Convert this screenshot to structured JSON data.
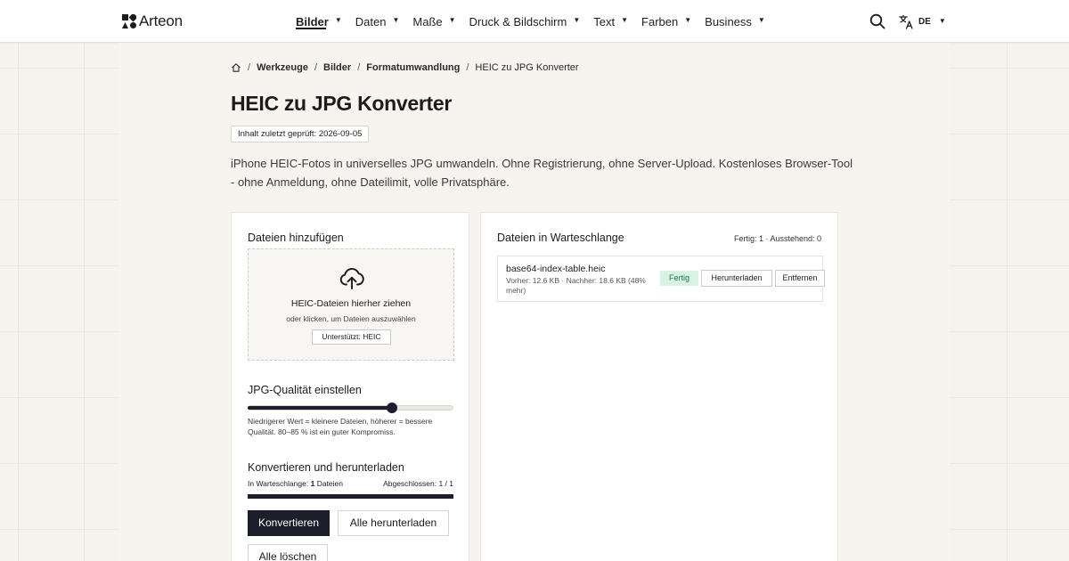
{
  "brand": {
    "name": "Arteon"
  },
  "nav": {
    "items": [
      {
        "label": "Bilder",
        "active": true
      },
      {
        "label": "Daten"
      },
      {
        "label": "Maße"
      },
      {
        "label": "Druck & Bildschirm"
      },
      {
        "label": "Text"
      },
      {
        "label": "Farben"
      },
      {
        "label": "Business"
      }
    ],
    "caret_glyph": "▼"
  },
  "header": {
    "search_icon": "search-icon",
    "language_icon": "translate-icon",
    "language_code": "DE"
  },
  "breadcrumb": {
    "home_icon": "home-icon",
    "separator": "/",
    "items": [
      "Werkzeuge",
      "Bilder",
      "Formatumwandlung"
    ],
    "current": "HEIC zu JPG Konverter"
  },
  "page": {
    "title": "HEIC zu JPG Konverter",
    "reviewed": "Inhalt zuletzt geprüft: 2026-09-05",
    "intro": "iPhone HEIC-Fotos in universelles JPG umwandeln. Ohne Registrierung, ohne Server-Upload. Kostenloses Browser-Tool - ohne Anmeldung, ohne Dateilimit, volle Privatsphäre."
  },
  "upload": {
    "title": "Dateien hinzufügen",
    "dropzone_title": "HEIC-Dateien hierher ziehen",
    "dropzone_sub": "oder klicken, um Dateien auszuwählen",
    "supported": "Unterstützt: HEIC",
    "icon": "cloud-upload-icon"
  },
  "quality": {
    "title": "JPG-Qualität einstellen",
    "value_fraction": 0.7,
    "hint": "Niedrigerer Wert = kleinere Dateien, höherer = bessere Qualität. 80–85 % ist ein guter Kompromiss."
  },
  "convert": {
    "title": "Konvertieren und herunterladen",
    "queue_label": "In Warteschlange:",
    "queue_count": "1",
    "queue_unit": "Dateien",
    "done_text": "Abgeschlossen: 1 / 1",
    "progress_fraction": 1.0,
    "convert_button": "Konvertieren",
    "download_all_button": "Alle herunterladen",
    "clear_button": "Alle löschen"
  },
  "queue": {
    "title": "Dateien in Warteschlange",
    "counts": "Fertig: 1 · Ausstehend: 0",
    "files": [
      {
        "name": "base64-index-table.heic",
        "meta": "Vorher: 12.6 KB · Nachher: 18.6 KB (48% mehr)",
        "status": "Fertig",
        "download_label": "Herunterladen",
        "remove_label": "Entfernen"
      }
    ]
  },
  "colors": {
    "accent": "#1c1f2b",
    "success_bg": "#d8f3e4",
    "success_text": "#1d7a45",
    "background": "#f6f3ef"
  }
}
